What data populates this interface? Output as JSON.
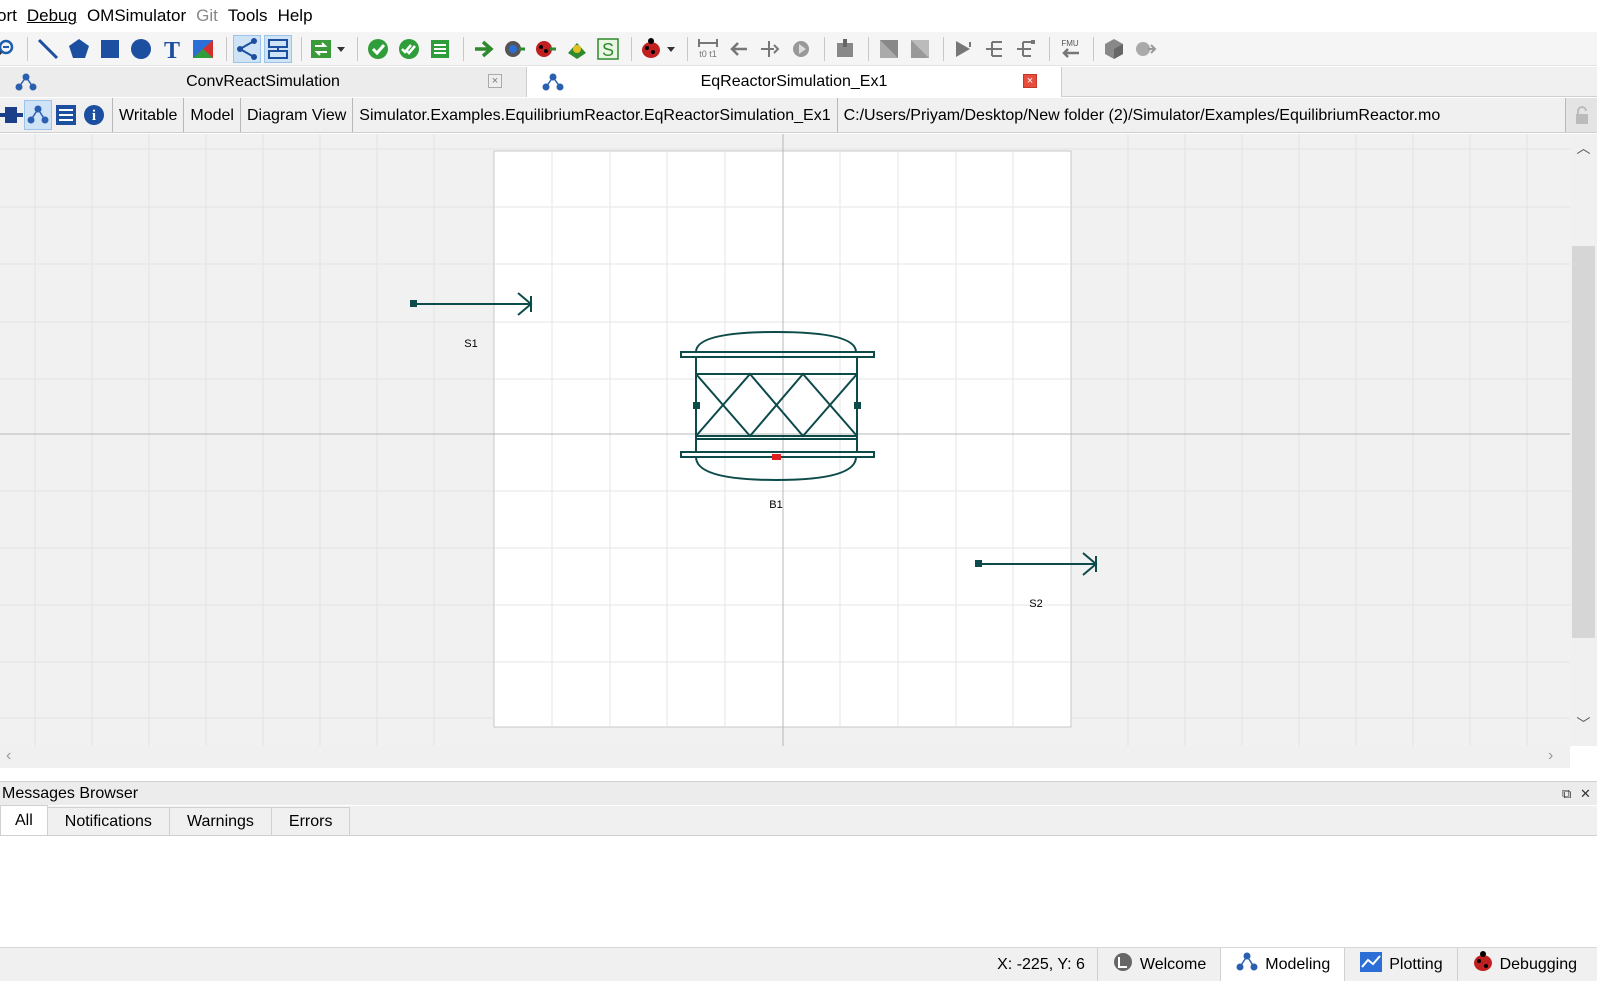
{
  "menubar": {
    "items": [
      {
        "label": "ort",
        "underline": ""
      },
      {
        "label": "Debug",
        "underline": "D"
      },
      {
        "label": "OMSimulator",
        "underline": "O"
      },
      {
        "label": "Git",
        "underline": "G",
        "disabled": true
      },
      {
        "label": "Tools",
        "underline": "T"
      },
      {
        "label": "Help",
        "underline": "H"
      }
    ]
  },
  "tabs": {
    "inactive": {
      "label": "ConvReactSimulation",
      "close": "×"
    },
    "active": {
      "label": "EqReactorSimulation_Ex1",
      "close": "×"
    }
  },
  "infobar": {
    "access": "Writable",
    "restriction": "Model",
    "view": "Diagram View",
    "class_path": "Simulator.Examples.EquilibriumReactor.EqReactorSimulation_Ex1",
    "file_path": "C:/Users/Priyam/Desktop/New folder (2)/Simulator/Examples/EquilibriumReactor.mo"
  },
  "diagram": {
    "components": [
      {
        "name": "S1",
        "type": "material-stream"
      },
      {
        "name": "B1",
        "type": "equilibrium-reactor"
      },
      {
        "name": "S2",
        "type": "material-stream"
      }
    ],
    "colors": {
      "icon_stroke": "#0d4a4a",
      "port_red": "#e02020"
    }
  },
  "messages": {
    "title": "Messages Browser",
    "tabs": [
      "All",
      "Notifications",
      "Warnings",
      "Errors"
    ],
    "active_tab": "All"
  },
  "status": {
    "coordinates": "X: -225, Y: 6",
    "perspectives": [
      {
        "label": "Welcome",
        "icon": "welcome-icon"
      },
      {
        "label": "Modeling",
        "icon": "modeling-icon",
        "active": true
      },
      {
        "label": "Plotting",
        "icon": "plotting-icon"
      },
      {
        "label": "Debugging",
        "icon": "debugging-icon"
      }
    ]
  }
}
